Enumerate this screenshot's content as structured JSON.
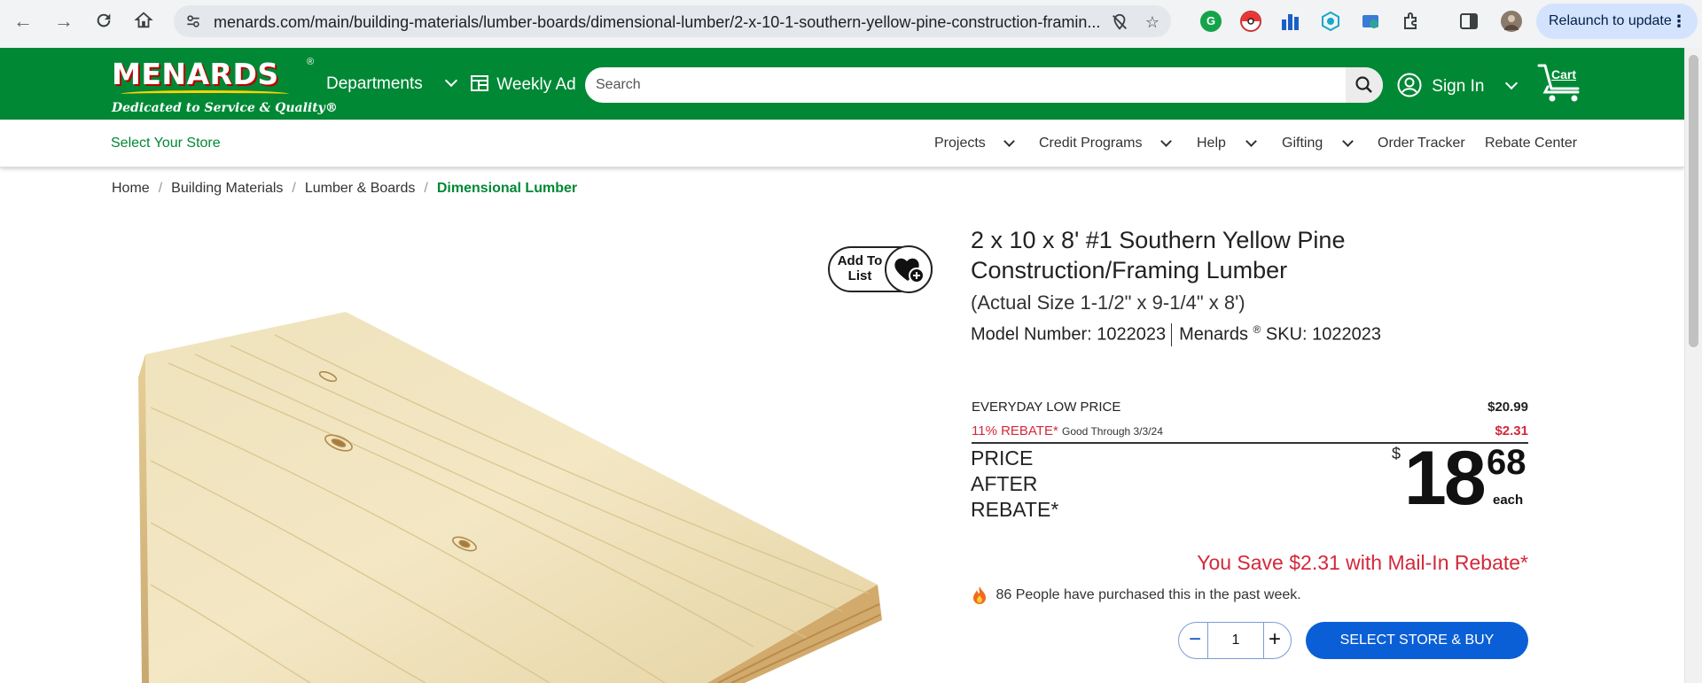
{
  "browser": {
    "url": "menards.com/main/building-materials/lumber-boards/dimensional-lumber/2-x-10-1-southern-yellow-pine-construction-framin...",
    "relaunch_label": "Relaunch to update"
  },
  "header": {
    "logo_text": "MENARDS",
    "logo_registered": "®",
    "tagline": "Dedicated to Service & Quality®",
    "departments_label": "Departments",
    "weekly_ad_label": "Weekly Ad",
    "search_placeholder": "Search",
    "sign_in_label": "Sign In",
    "cart_label": "Cart",
    "brand_color": "#008835"
  },
  "subnav": {
    "store_label": "Select Your Store",
    "items": [
      {
        "label": "Projects"
      },
      {
        "label": "Credit Programs"
      },
      {
        "label": "Help"
      },
      {
        "label": "Gifting"
      },
      {
        "label": "Order Tracker"
      },
      {
        "label": "Rebate Center"
      }
    ]
  },
  "breadcrumb": {
    "items": [
      "Home",
      "Building Materials",
      "Lumber & Boards"
    ],
    "current": "Dimensional Lumber"
  },
  "product": {
    "add_to_list_label": "Add To List",
    "title": "2 x 10 x 8' #1 Southern Yellow Pine Construction/Framing Lumber",
    "actual_size": "(Actual Size 1-1/2\" x 9-1/4\" x 8')",
    "model_label": "Model Number: 1022023",
    "brand": "Menards",
    "brand_reg": "®",
    "sku_label": "SKU: 1022023"
  },
  "pricing": {
    "everyday_label": "EVERYDAY LOW PRICE",
    "everyday_price": "$20.99",
    "rebate_label": "11% REBATE*",
    "rebate_good_through": "Good Through 3/3/24",
    "rebate_amount": "$2.31",
    "par_line1": "PRICE",
    "par_line2": "AFTER",
    "par_line3": "REBATE*",
    "currency_symbol": "$",
    "price_dollars": "18",
    "price_cents": "68",
    "unit": "each",
    "savings_text": "You Save $2.31 with Mail-In Rebate*",
    "savings_color": "#d4283a"
  },
  "social_proof": {
    "text": "86 People have purchased this in the past week."
  },
  "purchase": {
    "quantity": "1",
    "minus_label": "−",
    "plus_label": "+",
    "buy_label": "SELECT STORE & BUY",
    "button_color": "#0b5fd6"
  }
}
